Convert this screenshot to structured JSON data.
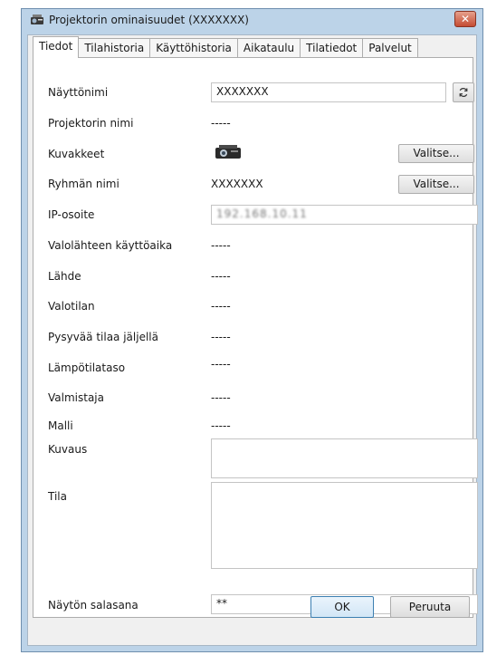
{
  "window": {
    "title": "Projektorin ominaisuudet (XXXXXXX)",
    "close_label": "✕"
  },
  "tabs": [
    {
      "label": "Tiedot",
      "active": true
    },
    {
      "label": "Tilahistoria"
    },
    {
      "label": "Käyttöhistoria"
    },
    {
      "label": "Aikataulu"
    },
    {
      "label": "Tilatiedot"
    },
    {
      "label": "Palvelut"
    }
  ],
  "fields": {
    "display_name_label": "Näyttönimi",
    "display_name_value": "XXXXXXX",
    "projector_name_label": "Projektorin nimi",
    "projector_name_value": "-----",
    "icons_label": "Kuvakkeet",
    "icons_choose": "Valitse...",
    "group_name_label": "Ryhmän nimi",
    "group_name_value": "XXXXXXX",
    "group_choose": "Valitse...",
    "ip_label": "IP-osoite",
    "ip_value": "192.168.10.11",
    "light_time_label": "Valolähteen käyttöaika",
    "light_time_value": "-----",
    "source_label": "Lähde",
    "source_value": "-----",
    "light_mode_label": "Valotilan",
    "light_mode_value": "-----",
    "standby_label": "Pysyvää tilaa jäljellä",
    "standby_value": "-----",
    "temp_label": "Lämpötilataso",
    "temp_value": "-----",
    "maker_label": "Valmistaja",
    "maker_value": "-----",
    "model_label": "Malli",
    "model_value": "-----",
    "description_label": "Kuvaus",
    "description_value": "",
    "status_label": "Tila",
    "status_value": "",
    "password_label": "Näytön salasana",
    "password_value": "**"
  },
  "buttons": {
    "ok": "OK",
    "cancel": "Peruuta"
  },
  "icons": {
    "title_icon": "projector-properties-icon",
    "refresh_icon": "refresh-icon",
    "projector_icon": "projector-icon"
  }
}
